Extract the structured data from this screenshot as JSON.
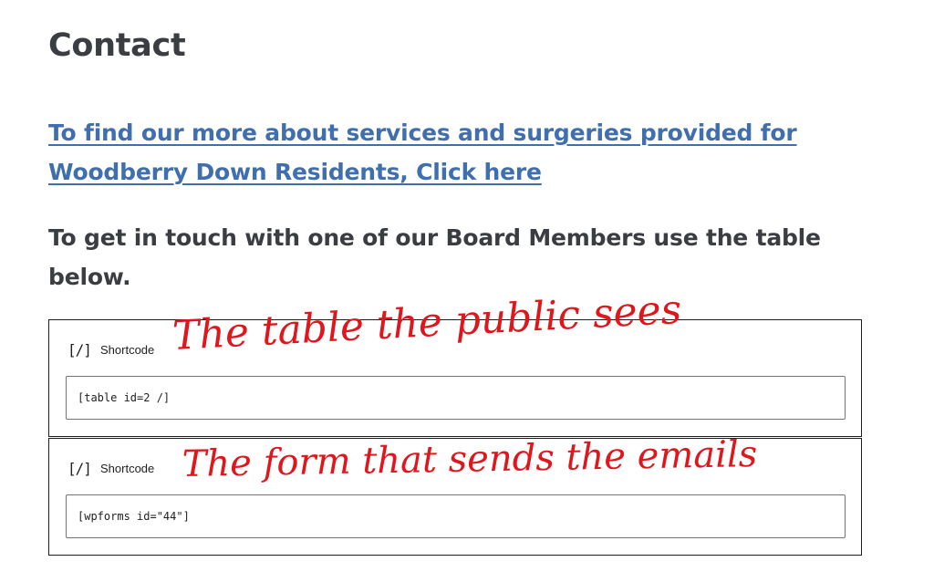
{
  "page": {
    "title": "Contact",
    "services_link": "To find our more about services and surgeries provided for Woodberry Down Residents, Click here",
    "intro": "To get in touch with one of our Board Members use the table below."
  },
  "blocks": [
    {
      "icon": "[/]",
      "icon_name": "shortcode-icon",
      "label": "Shortcode",
      "value": "[table id=2 /]"
    },
    {
      "icon": "[/]",
      "icon_name": "shortcode-icon",
      "label": "Shortcode",
      "value": "[wpforms id=\"44\"]"
    }
  ],
  "annotations": {
    "table_note": "The table the public sees",
    "form_note": "The form that sends the emails"
  },
  "colors": {
    "link": "#3f6fae",
    "heading": "#3a3d42",
    "annotation": "#e0161d",
    "border": "#1e1e1e"
  }
}
